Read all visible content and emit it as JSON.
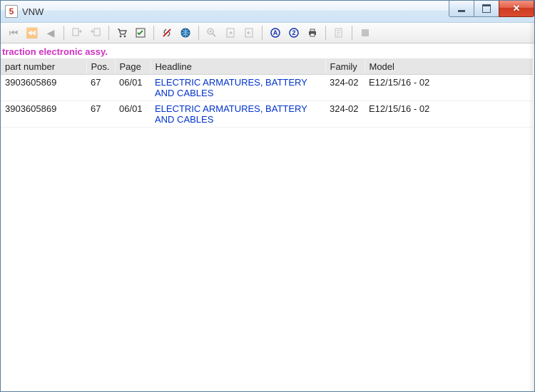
{
  "window": {
    "title": "VNW",
    "app_icon_text": "5"
  },
  "section_title": "traction electronic assy.",
  "columns": {
    "part_number": "part number",
    "pos": "Pos.",
    "page": "Page",
    "headline": "Headline",
    "family": "Family",
    "model": "Model"
  },
  "rows": [
    {
      "part_number": "3903605869",
      "pos": "67",
      "page": "06/01",
      "headline": "ELECTRIC ARMATURES, BATTERY AND CABLES",
      "family": "324-02",
      "model": "E12/15/16 - 02"
    },
    {
      "part_number": "3903605869",
      "pos": "67",
      "page": "06/01",
      "headline": "ELECTRIC ARMATURES, BATTERY AND CABLES",
      "family": "324-02",
      "model": "E12/15/16 - 02"
    }
  ],
  "toolbar_icons": {
    "first": "first-icon",
    "rewind": "rewind-icon",
    "prev": "prev-icon",
    "copy_in": "copy-in-icon",
    "copy_out": "copy-out-icon",
    "cart": "cart-icon",
    "checklist": "checklist-icon",
    "unlink": "unlink-icon",
    "globe": "globe-icon",
    "zoom": "zoom-icon",
    "page_next": "page-next-icon",
    "page_prev": "page-prev-icon",
    "marker_a": "marker-a-icon",
    "marker_b": "marker-b-icon",
    "print": "print-icon",
    "note": "note-icon",
    "stop": "stop-icon"
  }
}
